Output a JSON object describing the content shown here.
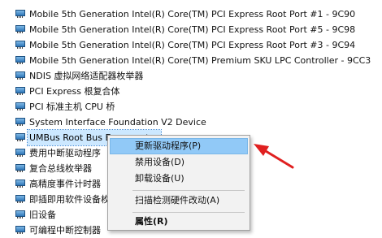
{
  "device_list": [
    "Mobile 5th Generation Intel(R) Core(TM) PCI Express Root Port #1 - 9C90",
    "Mobile 5th Generation Intel(R) Core(TM) PCI Express Root Port #5 - 9C98",
    "Mobile 5th Generation Intel(R) Core(TM) PCI Express Root Port #3 - 9C94",
    "Mobile 5th Generation Intel(R) Core(TM) Premium SKU LPC Controller - 9CC3",
    "NDIS 虚拟网络适配器枚举器",
    "PCI Express 根复合体",
    "PCI 标准主机 CPU 桥",
    "System Interface Foundation V2 Device",
    "UMBus Root Bus Enumerator",
    "费用中断驱动程序",
    "复合总线枚举器",
    "高精度事件计时器",
    "即插即用软件设备枚",
    "旧设备",
    "可编程中断控制器"
  ],
  "context_menu": {
    "update_driver": "更新驱动程序(P)",
    "disable_device": "禁用设备(D)",
    "uninstall_device": "卸载设备(U)",
    "scan_hardware": "扫描检测硬件改动(A)",
    "properties": "属性(R)"
  },
  "colors": {
    "selection": "#cce8ff",
    "menu_hover": "#91c9f7",
    "annotation_arrow": "#e02020"
  },
  "icons": {
    "device": "device-icon",
    "annotation": "red-arrow-icon"
  }
}
